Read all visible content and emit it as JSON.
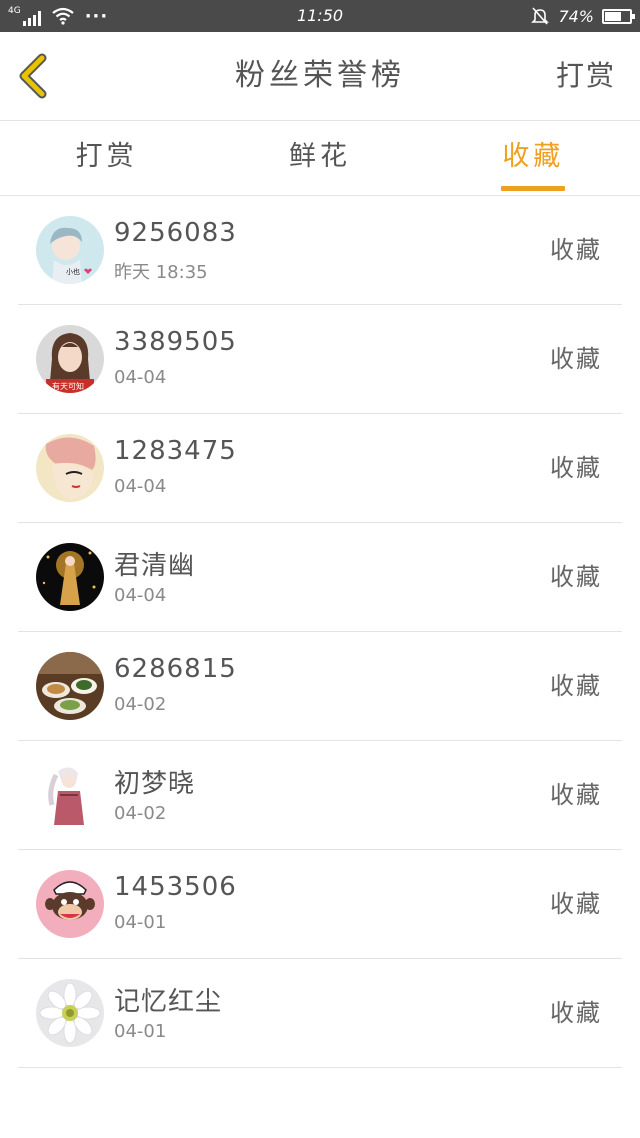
{
  "status_bar": {
    "network": "4G",
    "time": "11:50",
    "battery_text": "74%",
    "battery_level": 0.74
  },
  "nav": {
    "title": "粉丝荣誉榜",
    "action": "打赏"
  },
  "tabs": [
    {
      "label": "打赏",
      "active": false
    },
    {
      "label": "鲜花",
      "active": false
    },
    {
      "label": "收藏",
      "active": true
    }
  ],
  "colors": {
    "accent": "#f0a020",
    "back_icon": "#e8c300",
    "status_bar_bg": "#4a4a4a"
  },
  "list": [
    {
      "name": "9256083",
      "date": "昨天 18:35",
      "action": "收藏",
      "avatar_icon": "anime-girl-avatar-icon"
    },
    {
      "name": "3389505",
      "date": "04-04",
      "action": "收藏",
      "avatar_icon": "girl-photo-avatar-icon"
    },
    {
      "name": "1283475",
      "date": "04-04",
      "action": "收藏",
      "avatar_icon": "illustrated-face-avatar-icon"
    },
    {
      "name": "君清幽",
      "date": "04-04",
      "action": "收藏",
      "avatar_icon": "fantasy-figure-avatar-icon"
    },
    {
      "name": "6286815",
      "date": "04-02",
      "action": "收藏",
      "avatar_icon": "food-avatar-icon"
    },
    {
      "name": "初梦晓",
      "date": "04-02",
      "action": "收藏",
      "avatar_icon": "anime-figure-avatar-icon"
    },
    {
      "name": "1453506",
      "date": "04-01",
      "action": "收藏",
      "avatar_icon": "monkey-avatar-icon"
    },
    {
      "name": "记忆红尘",
      "date": "04-01",
      "action": "收藏",
      "avatar_icon": "flower-avatar-icon"
    }
  ]
}
